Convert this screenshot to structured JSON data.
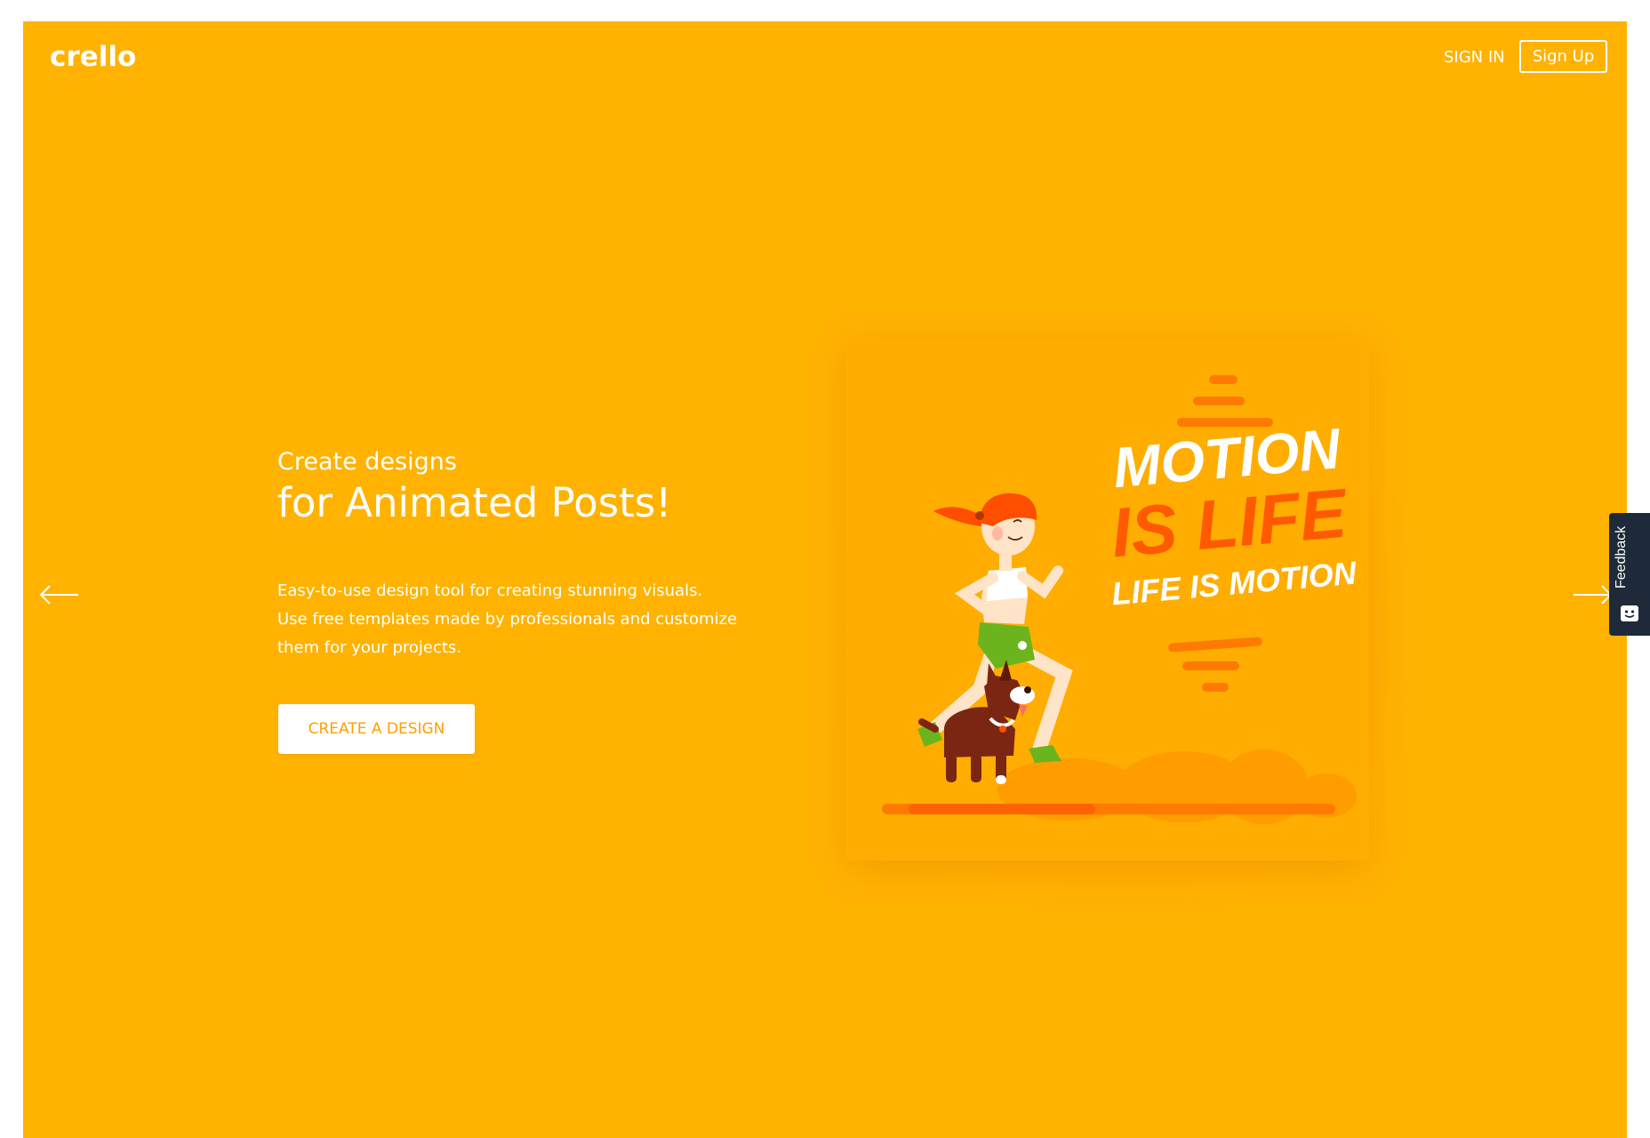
{
  "brand": {
    "logo_text": "crello"
  },
  "nav": {
    "sign_in": "SIGN IN",
    "sign_up": "Sign Up"
  },
  "hero": {
    "subtitle": "Create designs",
    "title": "for Animated Posts!",
    "description": [
      "Easy-to-use design tool for creating stunning visuals.",
      "Use free templates made by professionals and customize",
      "them for your projects."
    ],
    "cta": "CREATE A DESIGN"
  },
  "preview": {
    "lines": [
      "MOTION",
      "IS LIFE",
      "LIFE IS MOTION"
    ]
  },
  "feedback": {
    "label": "Feedback"
  },
  "colors": {
    "background": "#ffb300",
    "card": "#ffad00",
    "accent_orange": "#ff5a00",
    "cta_text": "#ffa000",
    "feedback_tab": "#1e2a3a"
  },
  "icons": {
    "arrow_left": "arrow-left-icon",
    "arrow_right": "arrow-right-icon",
    "feedback": "feedback-smiley-icon"
  }
}
